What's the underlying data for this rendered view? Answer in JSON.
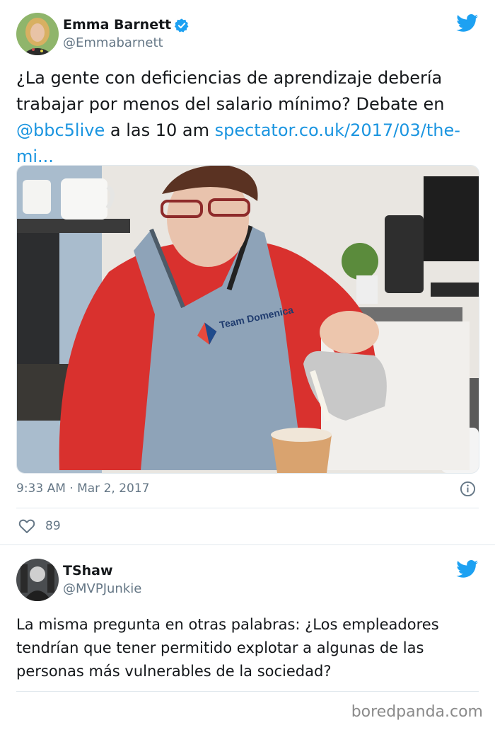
{
  "tweets": [
    {
      "name": "Emma Barnett",
      "handle": "@Emmabarnett",
      "verified": true,
      "text_parts": [
        "¿La gente con deficiencias de aprendizaje debería trabajar por menos del salario mínimo? Debate en ",
        "@bbc5live",
        " a las 10 am ",
        "spectator.co.uk/2017/03/the-mi..."
      ],
      "image_text": "Team Domenica",
      "timestamp": "9:33 AM · Mar 2, 2017",
      "likes": "89"
    },
    {
      "name": "TShaw",
      "handle": "@MVPJunkie",
      "text": "La misma pregunta en otras palabras: ¿Los empleadores tendrían que tener permitido explotar a algunas de las personas más vulnerables de la sociedad?"
    }
  ],
  "footer": "boredpanda.com",
  "colors": {
    "link": "#1b95e0",
    "muted": "#657786",
    "twitter_blue": "#1da1f2",
    "border": "#e1e8ed"
  }
}
